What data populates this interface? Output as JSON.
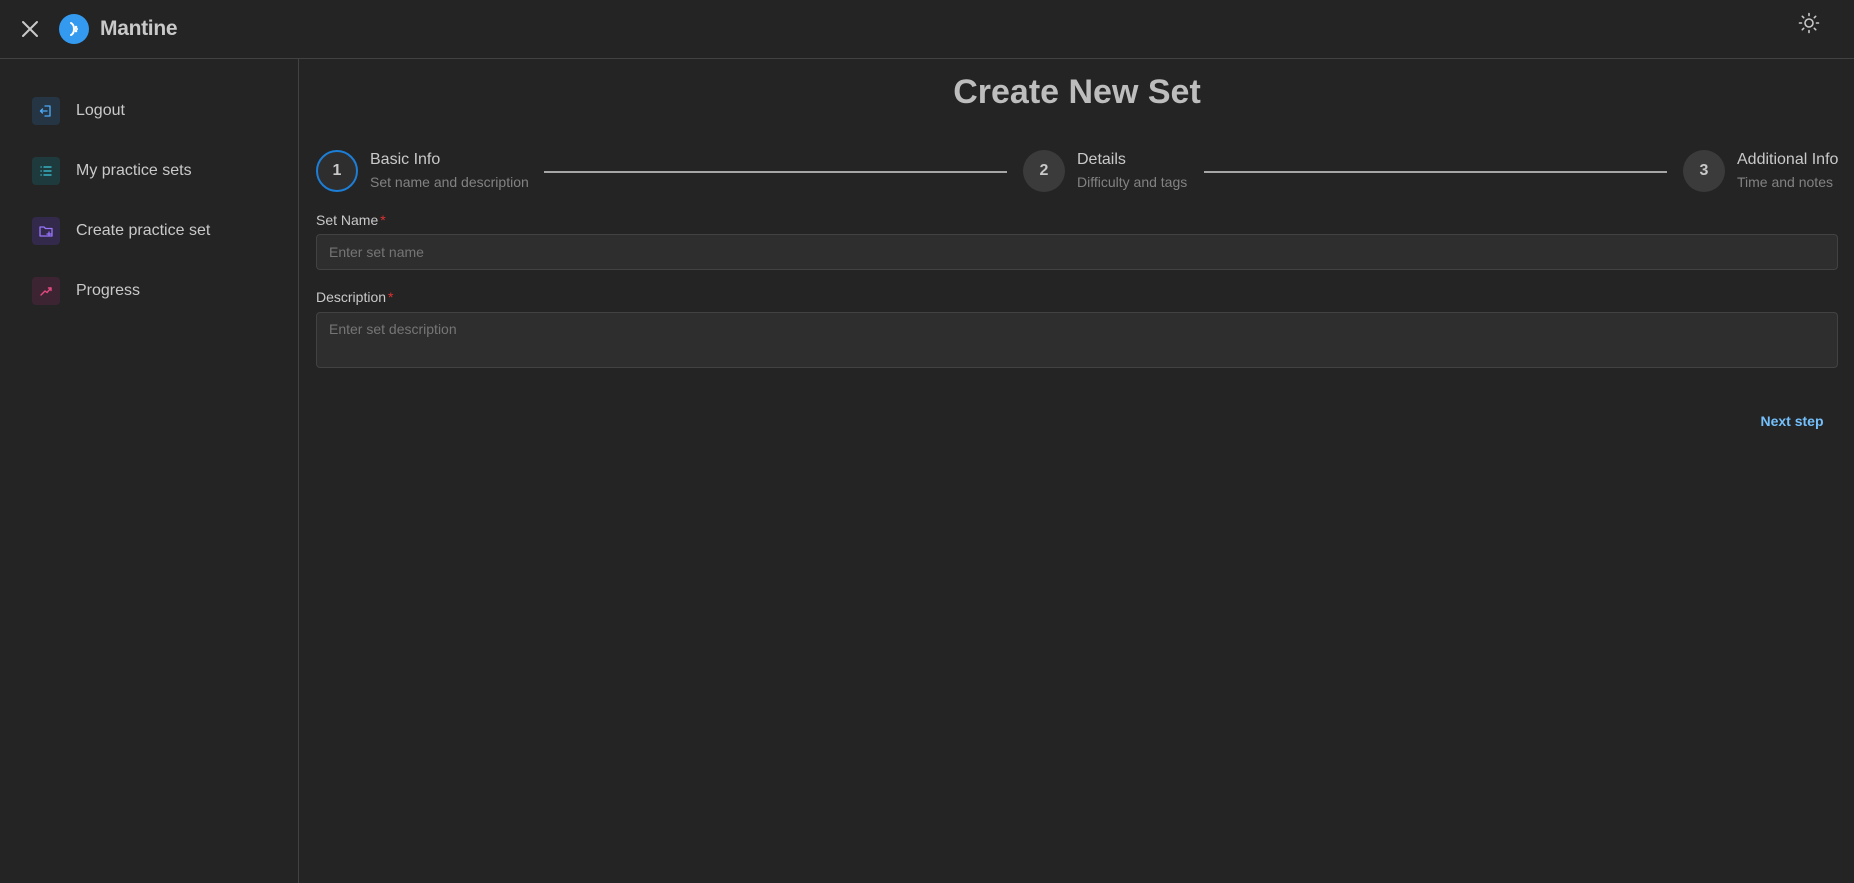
{
  "header": {
    "logo_text": "Mantine",
    "menu_icon": "close-icon",
    "theme_icon": "sun-icon"
  },
  "sidebar": {
    "items": [
      {
        "label": "Logout",
        "icon": "logout-icon",
        "color": "#4dabf7",
        "bg": "#253544"
      },
      {
        "label": "My practice sets",
        "icon": "list-icon",
        "color": "#3bc9db",
        "bg": "#1f3a3d"
      },
      {
        "label": "Create practice set",
        "icon": "folder-plus-icon",
        "color": "#9775fa",
        "bg": "#33294a"
      },
      {
        "label": "Progress",
        "icon": "trending-up-icon",
        "color": "#e64980",
        "bg": "#3d2433"
      }
    ]
  },
  "main": {
    "title": "Create New Set",
    "steps": [
      {
        "number": "1",
        "title": "Basic Info",
        "description": "Set name and description",
        "active": true
      },
      {
        "number": "2",
        "title": "Details",
        "description": "Difficulty and tags",
        "active": false
      },
      {
        "number": "3",
        "title": "Additional Info",
        "description": "Time and notes",
        "active": false
      }
    ],
    "form": {
      "set_name_label": "Set Name",
      "set_name_placeholder": "Enter set name",
      "set_name_value": "",
      "description_label": "Description",
      "description_placeholder": "Enter set description",
      "description_value": "",
      "required_marker": "*"
    },
    "next_button": "Next step"
  },
  "colors": {
    "background": "#242424",
    "accent": "#1c7ed6",
    "link": "#74c0fc",
    "required": "#e03131"
  }
}
